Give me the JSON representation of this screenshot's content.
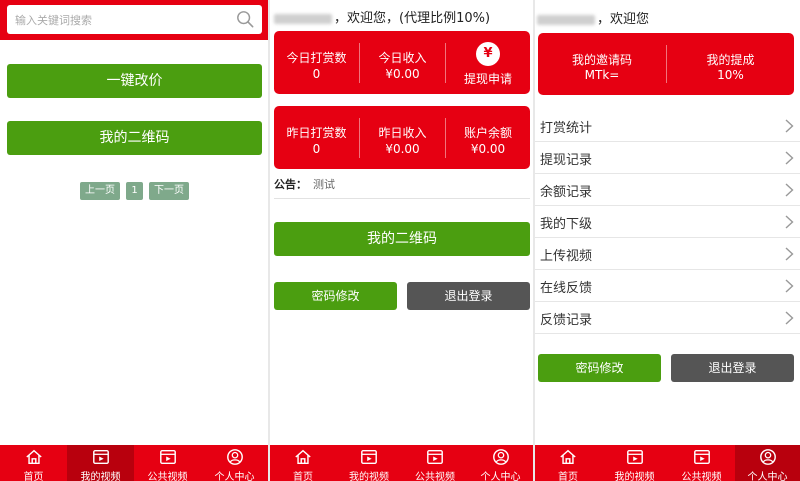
{
  "panel1": {
    "search_placeholder": "输入关键词搜索",
    "btn_reprice": "一键改价",
    "btn_qrcode": "我的二维码",
    "pager": {
      "prev": "上一页",
      "page": "1",
      "next": "下一页"
    }
  },
  "panel2": {
    "greeting": "，欢迎您，(代理比例10%)",
    "stats1": [
      {
        "label": "今日打赏数",
        "value": "0"
      },
      {
        "label": "今日收入",
        "value": "¥0.00"
      }
    ],
    "withdraw": {
      "icon": "¥",
      "label": "提现申请"
    },
    "stats2": [
      {
        "label": "昨日打赏数",
        "value": "0"
      },
      {
        "label": "昨日收入",
        "value": "¥0.00"
      },
      {
        "label": "账户余额",
        "value": "¥0.00"
      }
    ],
    "notice_label": "公告：",
    "notice_text": "测试",
    "btn_qrcode": "我的二维码",
    "btn_password": "密码修改",
    "btn_logout": "退出登录"
  },
  "panel3": {
    "greeting": "，欢迎您",
    "invite": {
      "label": "我的邀请码",
      "value": "MTk="
    },
    "commission": {
      "label": "我的提成",
      "value": "10%"
    },
    "menu": [
      {
        "label": "打赏统计"
      },
      {
        "label": "提现记录"
      },
      {
        "label": "余额记录"
      },
      {
        "label": "我的下级"
      },
      {
        "label": "上传视频"
      },
      {
        "label": "在线反馈"
      },
      {
        "label": "反馈记录"
      }
    ],
    "btn_password": "密码修改",
    "btn_logout": "退出登录"
  },
  "tabs": [
    "首页",
    "我的视频",
    "公共视频",
    "个人中心"
  ],
  "icons": {
    "tabs": [
      "home-icon",
      "video-icon",
      "video-icon",
      "user-icon"
    ],
    "search": "search-icon",
    "menu_arrow": "chevron-right-icon"
  },
  "colors": {
    "brand_red": "#e60012",
    "active_tab": "#b8000d",
    "green": "#4b9e10",
    "dark_gray": "#555555"
  },
  "active_tab_per_panel": [
    "我的视频",
    "",
    "个人中心"
  ]
}
